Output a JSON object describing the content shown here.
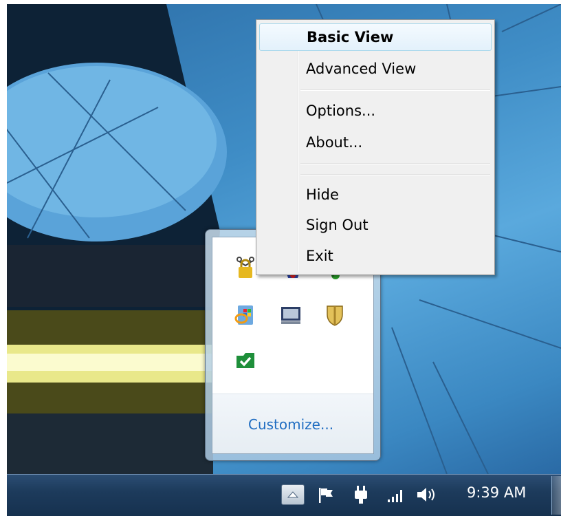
{
  "context_menu": {
    "items": [
      {
        "label": "Basic View",
        "bold": true,
        "highlighted": true
      },
      {
        "label": "Advanced View"
      },
      {
        "label": "Options..."
      },
      {
        "label": "About..."
      },
      {
        "label": "Hide"
      },
      {
        "label": "Sign Out"
      },
      {
        "label": "Exit"
      }
    ]
  },
  "tray_overflow": {
    "icons": [
      "vpn-lock-icon",
      "shield-network-icon",
      "green-sync-icon",
      "windows-update-icon",
      "display-icon",
      "security-shield-icon",
      "green-check-folder-icon"
    ],
    "customize_label": "Customize..."
  },
  "taskbar": {
    "tray_icons": [
      "show-hidden-icons-chevron",
      "action-center-flag-icon",
      "power-plug-icon",
      "signal-bars-icon",
      "volume-icon"
    ],
    "clock": "9:39 AM"
  },
  "colors": {
    "menu_background": "#f0f0f0",
    "menu_highlight_border": "#a8d8eb",
    "link_blue": "#1e6cc1",
    "taskbar": "#1d3b5c"
  }
}
